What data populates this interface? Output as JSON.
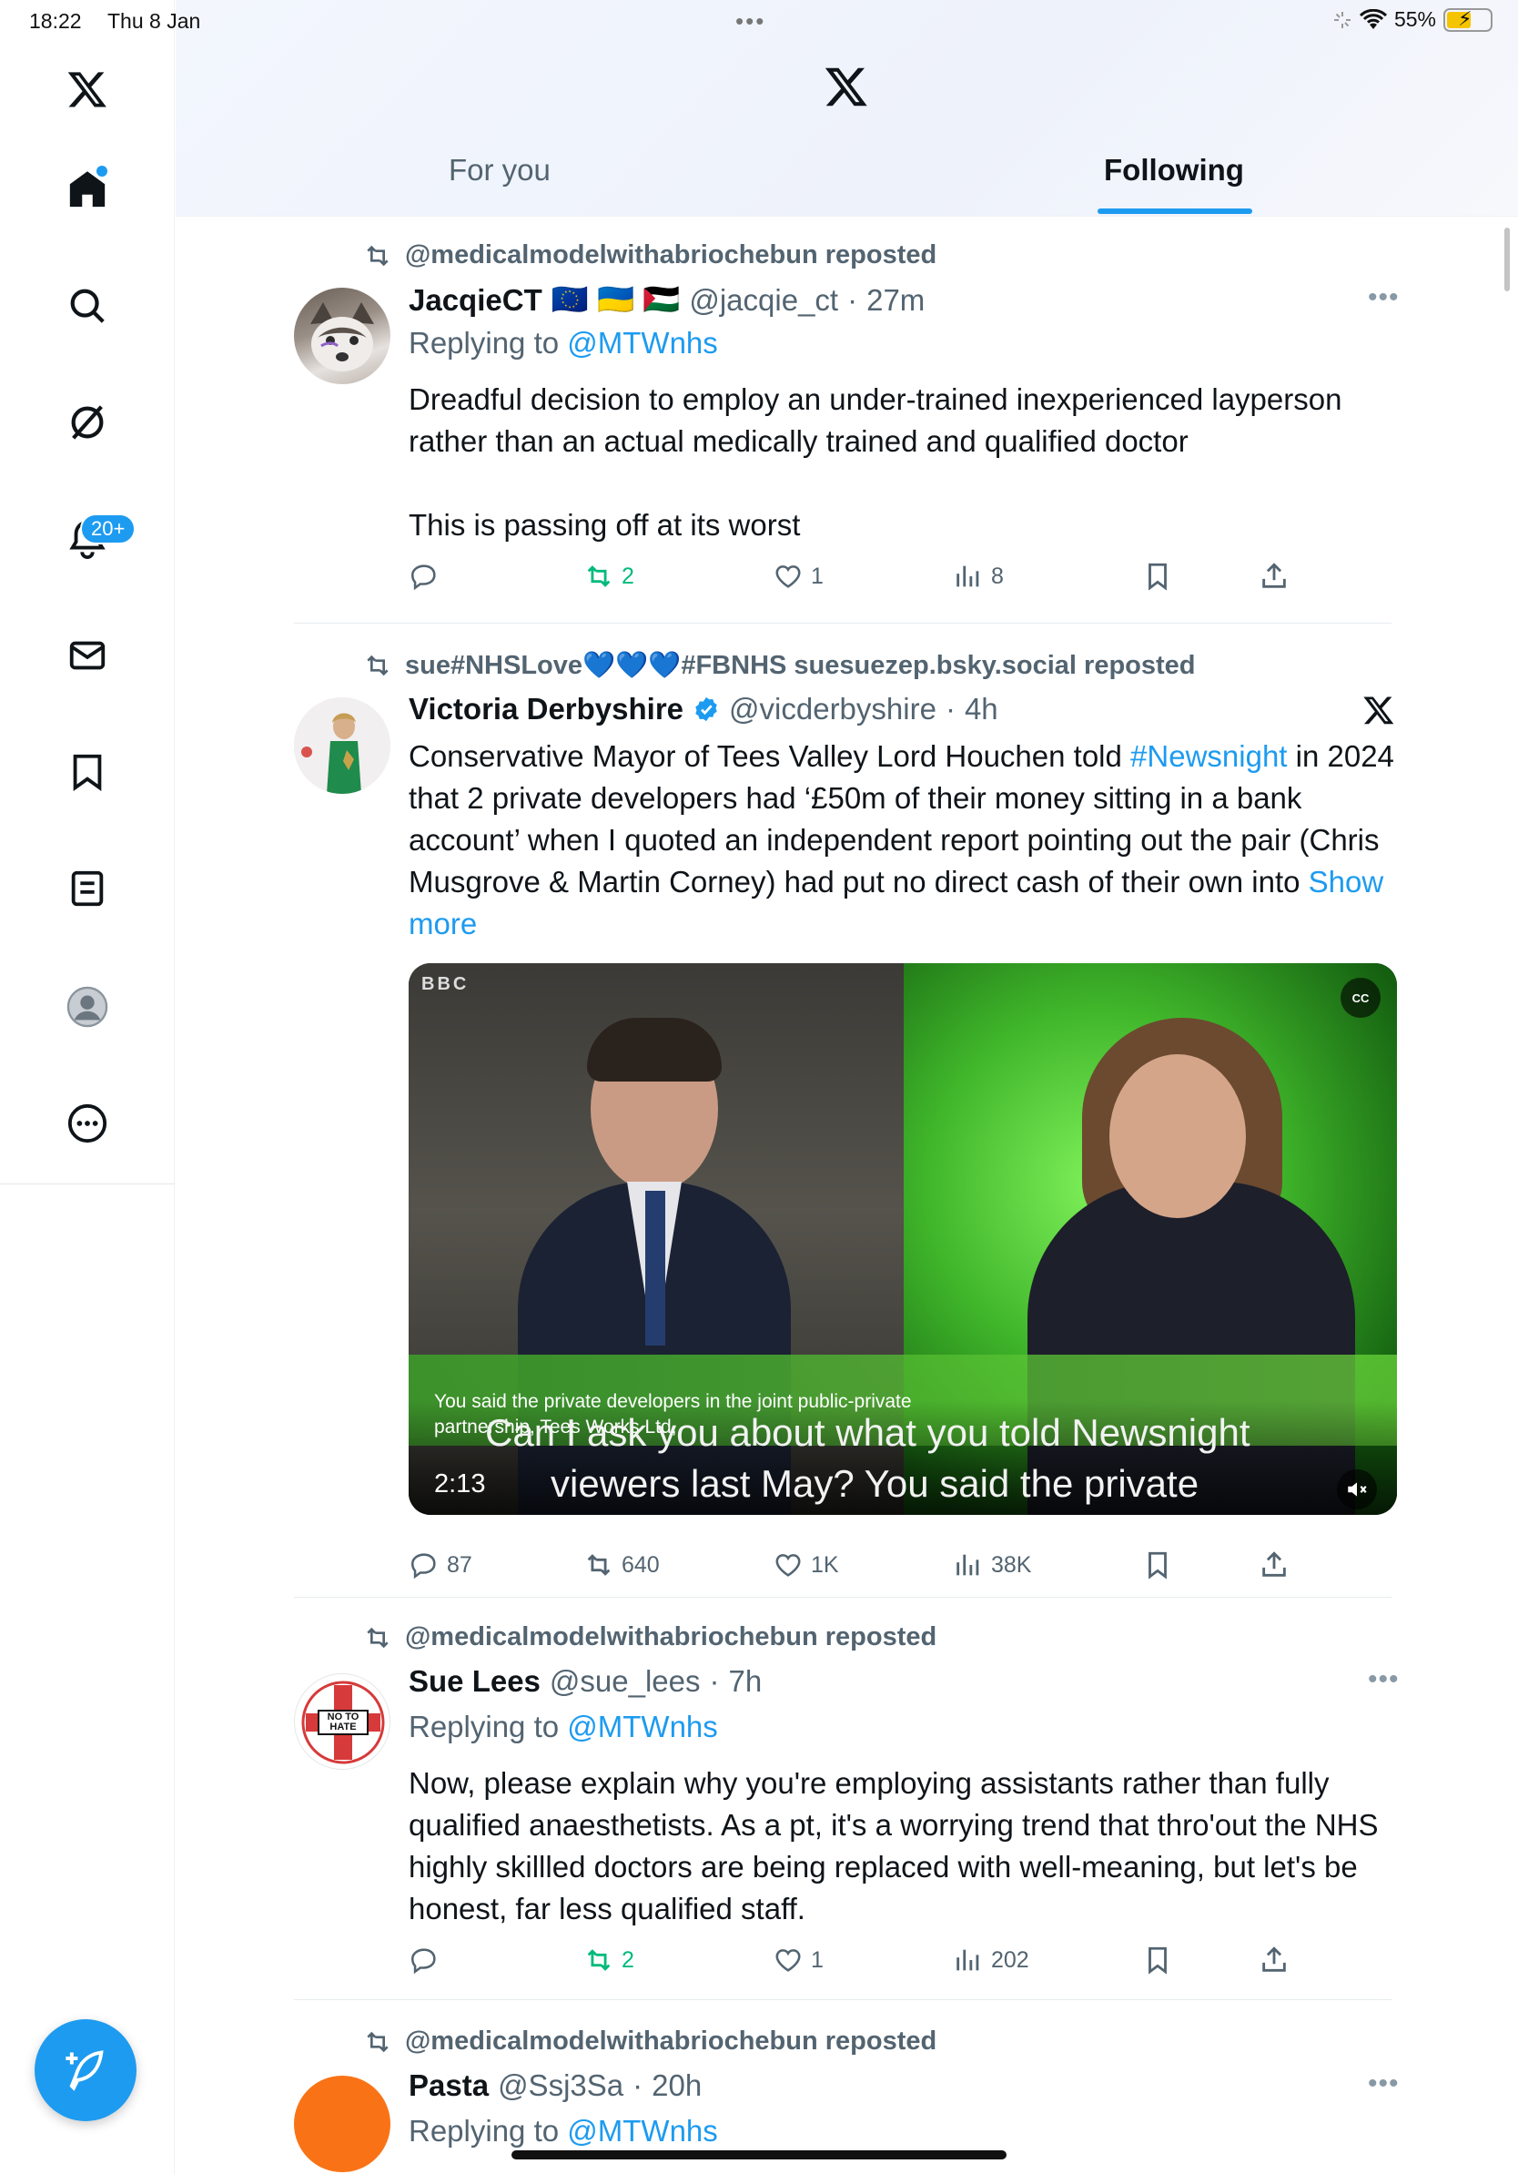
{
  "status_bar": {
    "time": "18:22",
    "date": "Thu 8 Jan",
    "battery": "55%"
  },
  "sidebar": {
    "notification_count": "20+",
    "items": [
      "X",
      "Home",
      "Search",
      "Grok",
      "Notifications",
      "Messages",
      "Bookmarks",
      "Lists",
      "Profile",
      "More"
    ]
  },
  "header": {
    "tabs": [
      {
        "label": "For you"
      },
      {
        "label": "Following"
      }
    ],
    "active_tab": "Following"
  },
  "posts": [
    {
      "repost_by": "@medicalmodelwithabriochebun reposted",
      "name": "JacqieCT",
      "flags": "🇪🇺 🇺🇦 🇵🇸",
      "handle": "@jacqie_ct",
      "time": "27m",
      "replying_label": "Replying to",
      "replying_to": "@MTWnhs",
      "text": "Dreadful decision to employ an under-trained inexperienced layperson rather than an actual medically trained and qualified doctor\n\nThis is passing off at its worst",
      "stats": {
        "replies": "",
        "reposts": "2",
        "likes": "1",
        "views": "8"
      }
    },
    {
      "repost_by": "sue#NHSLove💙💙💙#FBNHS suesuezep.bsky.social reposted",
      "name": "Victoria Derbyshire",
      "handle": "@vicderbyshire",
      "time": "4h",
      "text_before": "Conservative Mayor of Tees Valley Lord Houchen told ",
      "hashtag": "#Newsnight",
      "text_after": " in 2024 that 2 private developers had ‘£50m of their money sitting in a bank account’ when I quoted an independent report pointing out the pair (Chris Musgrove & Martin Corney) had put no direct cash of their own into ",
      "show_more": "Show more",
      "video": {
        "bbc_mark": "BBC",
        "cc_label": "CC",
        "caption_small": "You said the private developers in the joint public-private partnership, Tees Works Ltd,",
        "caption_line1": "Can I ask you about what you told Newsnight",
        "caption_line2": "viewers last May? You said the private",
        "duration": "2:13"
      },
      "stats": {
        "replies": "87",
        "reposts": "640",
        "likes": "1K",
        "views": "38K"
      }
    },
    {
      "repost_by": "@medicalmodelwithabriochebun reposted",
      "name": "Sue Lees",
      "handle": "@sue_lees",
      "time": "7h",
      "replying_label": "Replying to",
      "replying_to": "@MTWnhs",
      "avatar_text": "NO TO HATE",
      "text": "Now, please explain why you're employing assistants rather than fully qualified anaesthetists. As a pt, it's a worrying trend that thro'out the NHS highly skillled doctors are being replaced with well-meaning, but let's be honest, far less qualified staff.",
      "stats": {
        "replies": "",
        "reposts": "2",
        "likes": "1",
        "views": "202"
      }
    },
    {
      "repost_by": "@medicalmodelwithabriochebun reposted",
      "name": "Pasta",
      "handle": "@Ssj3Sa",
      "time": "20h",
      "replying_label": "Replying to",
      "replying_to": "@MTWnhs"
    }
  ],
  "colors": {
    "accent": "#1d9bf0",
    "repost_green": "#00ba7c",
    "secondary_text": "#536471",
    "pasta_avatar": "#f97316"
  },
  "icons": [
    "x-logo-icon",
    "home-icon",
    "search-icon",
    "grok-icon",
    "bell-icon",
    "mail-icon",
    "bookmark-icon",
    "list-icon",
    "profile-icon",
    "more-icon",
    "compose-icon",
    "repost-icon",
    "reply-icon",
    "like-icon",
    "views-icon",
    "share-icon",
    "verified-icon",
    "mute-icon"
  ]
}
